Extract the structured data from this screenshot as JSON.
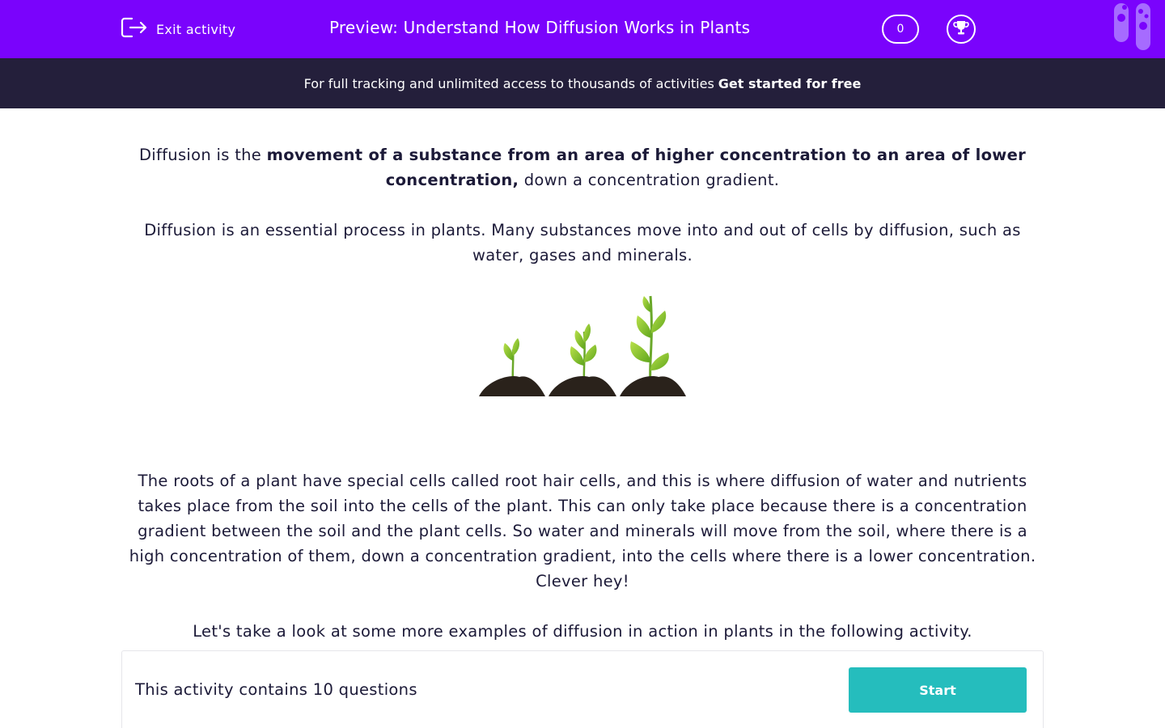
{
  "header": {
    "exit_label": "Exit activity",
    "title": "Preview: Understand How Diffusion Works in Plants",
    "score": "0"
  },
  "banner": {
    "text": "For full tracking and unlimited access to thousands of activities",
    "cta": "Get started for free"
  },
  "intro": {
    "p1_start": "Diffusion is the ",
    "p1_bold": "movement of a substance from an area of higher concentration to an area of lower concentration,",
    "p1_end": " down a concentration gradient.",
    "p2": "Diffusion is an essential process in plants. Many substances move into and out of cells by diffusion, such as water, gases and minerals.",
    "p3": "The roots of a plant have special cells called root hair cells, and this is where diffusion of water and nutrients takes place from the soil into the cells of the plant. This can only take place because there is a concentration gradient between the soil and the plant cells. So water and minerals will move from the soil, where there is a high concentration of them, down a concentration gradient, into the cells where there is a lower concentration. Clever hey!",
    "p4": "Let's take a look at some more examples of diffusion in action in plants in the following activity."
  },
  "activity": {
    "count_text": "This activity contains 10 questions",
    "start_label": "Start"
  },
  "colors": {
    "header_bg": "#7a03fc",
    "banner_bg": "#241f3b",
    "button": "#25bdbd",
    "text": "#1c1a38"
  },
  "icons": [
    "exit-icon",
    "trophy-icon",
    "test-tubes-icon",
    "seedling-icon"
  ]
}
